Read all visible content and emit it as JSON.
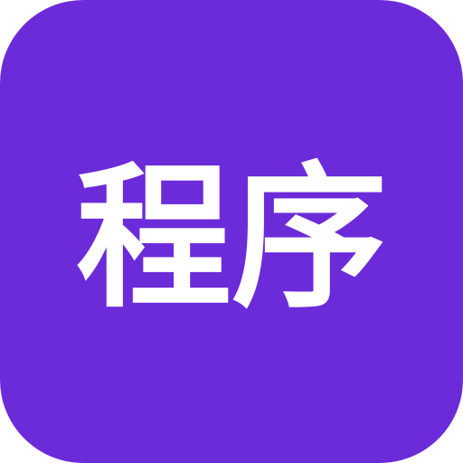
{
  "icon": {
    "label": "程序",
    "background_color": "#6c2bd9",
    "text_color": "#ffffff"
  }
}
